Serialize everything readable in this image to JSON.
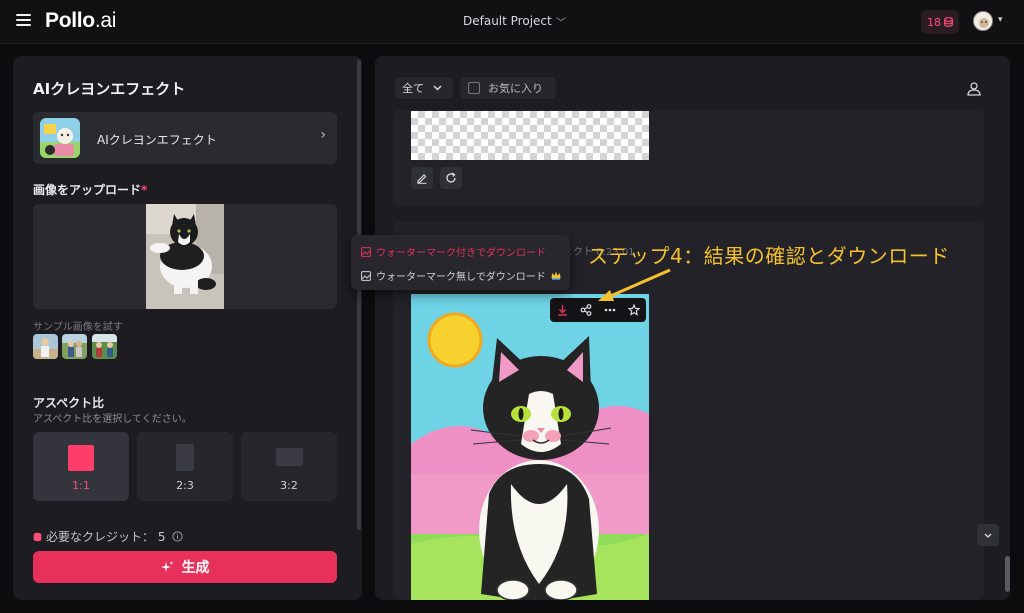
{
  "header": {
    "logo_main": "Pollo",
    "logo_suffix": ".ai",
    "project": "Default Project",
    "credits": "18"
  },
  "left_panel": {
    "title": "AIクレヨンエフェクト",
    "effect_card_label": "AIクレヨンエフェクト",
    "upload_label": "画像をアップロード",
    "required_mark": "*",
    "sample_label": "サンプル画像を試す",
    "aspect_title": "アスペクト比",
    "aspect_hint": "アスペクト比を選択してください。",
    "aspect_options": [
      "1:1",
      "2:3",
      "3:2"
    ],
    "aspect_selected": "1:1",
    "credits_needed_label": "必要なクレジット：",
    "credits_needed_value": "5",
    "generate_label": "生成"
  },
  "right_panel": {
    "filter_label": "全て",
    "favorites_label": "お気に入り",
    "card_meta": "ェクト   0:23 01"
  },
  "download_menu": {
    "with_watermark": "ウォーターマーク付きでダウンロード",
    "without_watermark": "ウォーターマーク無しでダウンロード"
  },
  "annotation": "ステップ4：結果の確認とダウンロード",
  "colors": {
    "accent": "#e8315a",
    "annotation": "#f6c12a",
    "background": "#0c0c0e",
    "panel": "#1c1c21"
  }
}
